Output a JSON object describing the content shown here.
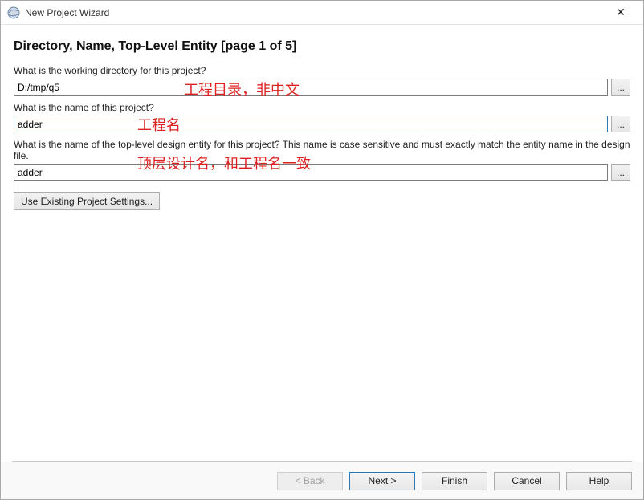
{
  "window": {
    "title": "New Project Wizard",
    "close_glyph": "✕"
  },
  "page": {
    "heading": "Directory, Name, Top-Level Entity [page 1 of 5]"
  },
  "fields": {
    "directory": {
      "label": "What is the working directory for this project?",
      "value": "D:/tmp/q5",
      "browse": "..."
    },
    "name": {
      "label": "What is the name of this project?",
      "value": "adder",
      "browse": "..."
    },
    "entity": {
      "label": "What is the name of the top-level design entity for this project? This name is case sensitive and must exactly match the entity name in the design file.",
      "value": "adder",
      "browse": "..."
    }
  },
  "buttons": {
    "existing": "Use Existing Project Settings...",
    "back": "< Back",
    "next": "Next >",
    "finish": "Finish",
    "cancel": "Cancel",
    "help": "Help"
  },
  "annotations": {
    "a1": "工程目录，非中文",
    "a2": "工程名",
    "a3": "顶层设计名，和工程名一致"
  }
}
